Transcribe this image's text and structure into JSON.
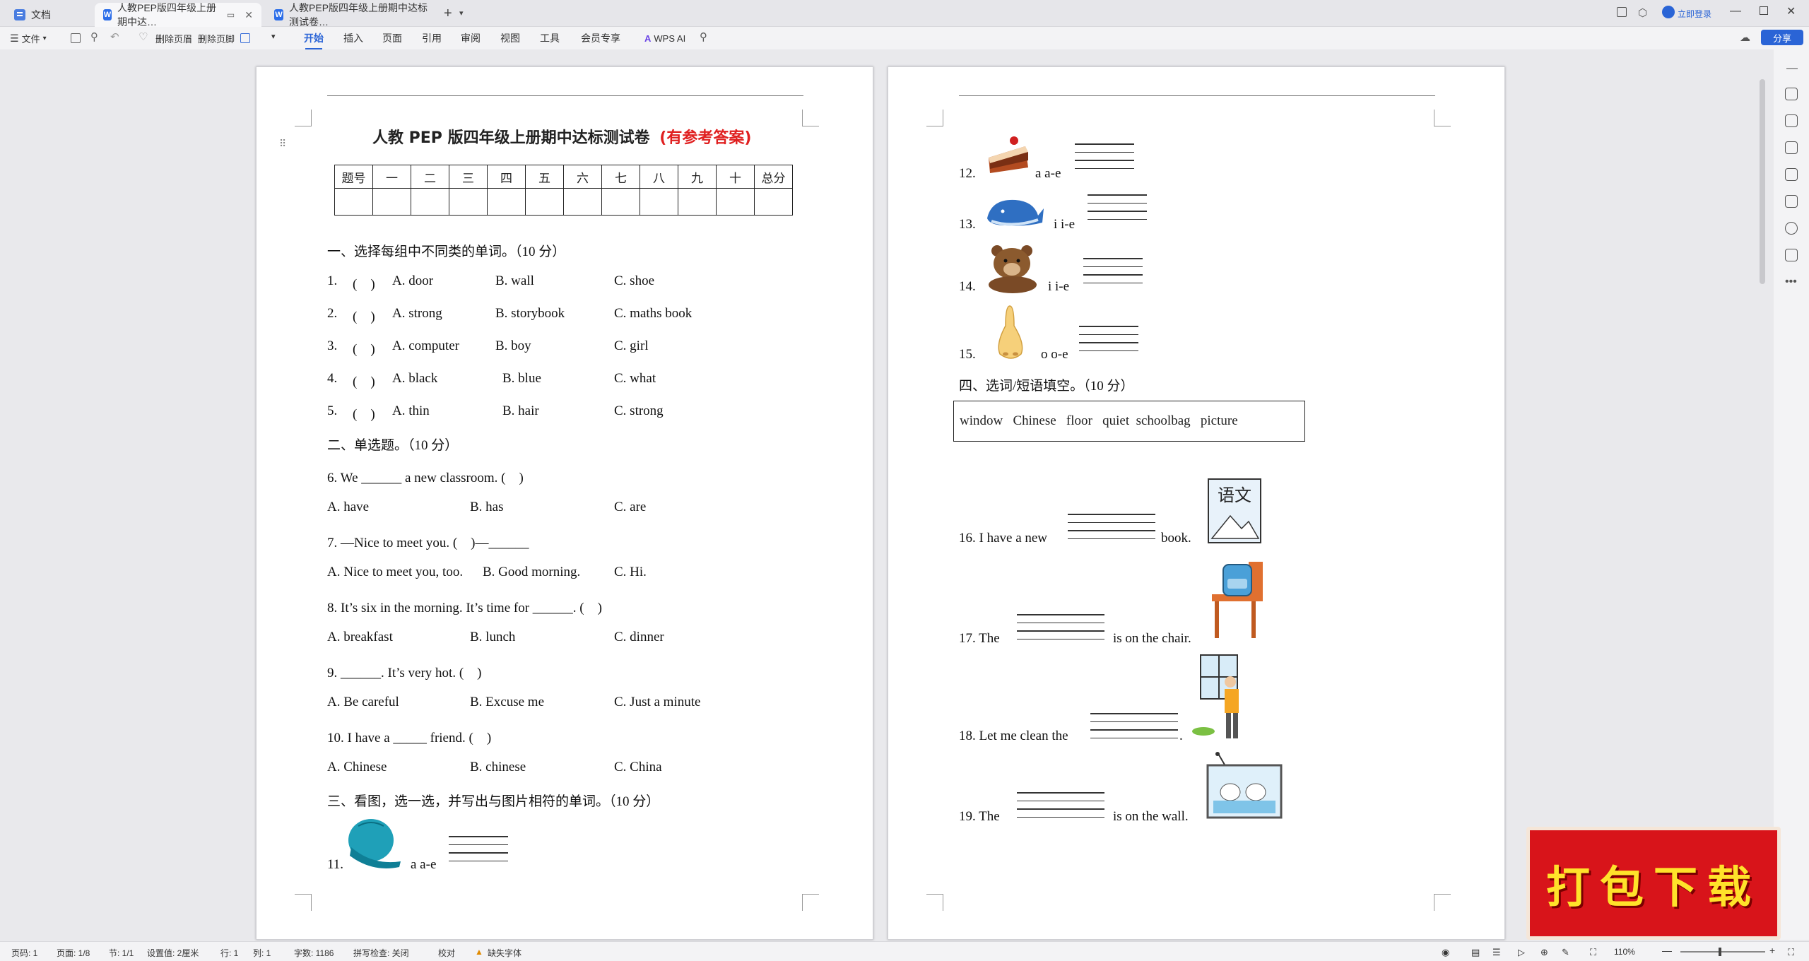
{
  "tabs": [
    {
      "label": "文档"
    },
    {
      "label": "人教PEP版四年级上册期中达…"
    },
    {
      "label": "人教PEP版四年级上册期中达标测试卷…"
    }
  ],
  "topright": {
    "login": "立即登录",
    "share": "分享"
  },
  "ribbon": {
    "file": "文件",
    "delete_header": "删除页眉",
    "delete_footer": "删除页脚",
    "menus": [
      "开始",
      "插入",
      "页面",
      "引用",
      "审阅",
      "视图",
      "工具",
      "会员专享"
    ],
    "wps_ai": "WPS AI"
  },
  "doc": {
    "title": "人教 PEP 版四年级上册期中达标测试卷",
    "title_note": "(有参考答案)",
    "score_headers": [
      "题号",
      "一",
      "二",
      "三",
      "四",
      "五",
      "六",
      "七",
      "八",
      "九",
      "十",
      "总分"
    ],
    "sec1": "一、选择每组中不同类的单词。（10 分）",
    "q1": [
      "1.",
      "(　)",
      "A.  door",
      "B.  wall",
      "C.  shoe"
    ],
    "q2": [
      "2.",
      "(　)",
      "A.  strong",
      "B.  storybook",
      "C.  maths book"
    ],
    "q3": [
      "3.",
      "(　)",
      "A.  computer",
      "B.  boy",
      "C.  girl"
    ],
    "q4": [
      "4.",
      "(　)",
      "A.  black",
      "B.  blue",
      "C.  what"
    ],
    "q5": [
      "5.",
      "(　)",
      "A.  thin",
      "B.  hair",
      "C.  strong"
    ],
    "sec2": "二、单选题。（10 分）",
    "q6": "6.   We ______ a new classroom. (　)",
    "q6o": [
      "A.  have",
      "B.  has",
      "C.  are"
    ],
    "q7": "7.   —Nice to meet you. (　)—______",
    "q7o": [
      "A.  Nice to meet you, too.",
      "B.  Good morning.",
      "C.  Hi."
    ],
    "q8": "8.   It’s six in the morning. It’s time for ______. (　)",
    "q8o": [
      "A.  breakfast",
      "B.  lunch",
      "C.  dinner"
    ],
    "q9": "9.   ______. It’s very hot. (　)",
    "q9o": [
      "A.  Be careful",
      "B.  Excuse me",
      "C.  Just a minute"
    ],
    "q10": "10.   I have a _____ friend. (　)",
    "q10o": [
      "A.  Chinese",
      "B.  chinese",
      "C.  China"
    ],
    "sec3": "三、看图，选一选，并写出与图片相符的单词。（10 分）",
    "q11": [
      "11.",
      "a  a-e"
    ],
    "q12": [
      "12.",
      "a  a-e"
    ],
    "q13": [
      "13.",
      "i  i-e"
    ],
    "q14": [
      "14.",
      "i  i-e"
    ],
    "q15": [
      "15.",
      "o  o-e"
    ],
    "sec4": "四、选词/短语填空。（10 分）",
    "words": "window   Chinese   floor   quiet  schoolbag   picture",
    "q16": [
      "16.   I have a new",
      "book."
    ],
    "book_label": "语文",
    "q17": [
      "17.   The",
      "is on the chair."
    ],
    "q18": [
      "18.   Let me clean the",
      "."
    ],
    "q19": [
      "19.   The",
      "is on the wall."
    ]
  },
  "status": {
    "page": "页码: 1",
    "pages": "页面: 1/8",
    "section": "节: 1/1",
    "setting": "设置值: 2厘米",
    "row": "行: 1",
    "col": "列: 1",
    "words": "字数: 1186",
    "spell": "拼写检查: 关闭",
    "proof": "校对",
    "font_missing": "缺失字体",
    "zoom": "110%"
  },
  "banner": "打包下载",
  "colors": {
    "accent": "#2a64d6",
    "title_note": "#e02020",
    "banner": "#d8141a"
  }
}
